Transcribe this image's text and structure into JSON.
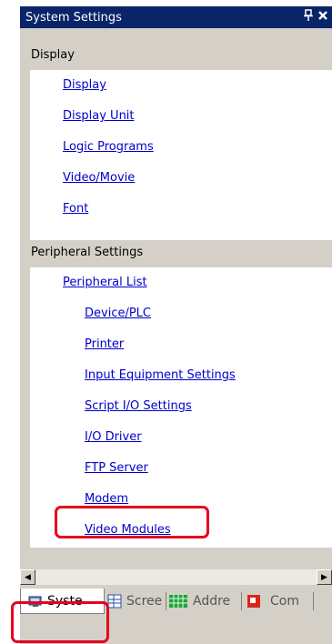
{
  "title_bar": {
    "title": "System Settings",
    "pin_glyph": "⭱",
    "close_glyph": "✖"
  },
  "sections": [
    {
      "header": "Display",
      "links": [
        "Display",
        "Display Unit",
        "Logic Programs",
        "Video/Movie",
        "Font"
      ]
    },
    {
      "header": "Peripheral Settings",
      "parent_link": "Peripheral List",
      "links": [
        "Device/PLC",
        "Printer",
        "Input Equipment Settings",
        "Script I/O Settings",
        "I/O Driver",
        "FTP Server",
        "Modem",
        "Video Modules"
      ]
    }
  ],
  "scrollbar": {
    "left_arrow": "◀",
    "right_arrow": "▶"
  },
  "tabs": [
    {
      "label": "Syste",
      "icon": "system-settings-icon",
      "active": true
    },
    {
      "label": "Scree",
      "icon": "screen-list-icon"
    },
    {
      "label": "Addre",
      "icon": "address-icon"
    },
    {
      "label": "Com",
      "icon": "common-settings-icon"
    }
  ],
  "highlight_color": "#e8001c"
}
